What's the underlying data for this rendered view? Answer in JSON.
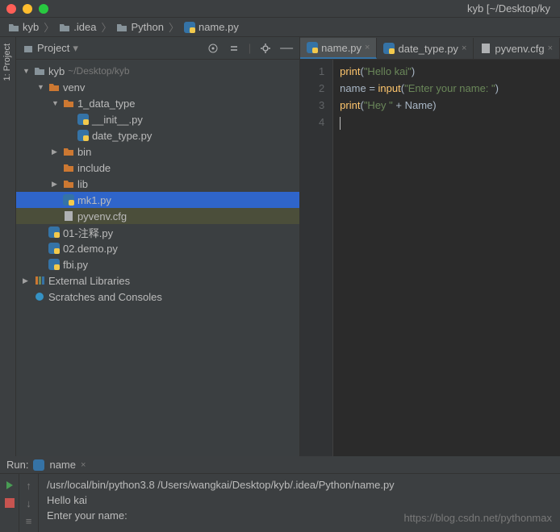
{
  "window": {
    "title": "kyb [~/Desktop/ky"
  },
  "breadcrumb": [
    {
      "icon": "folder",
      "label": "kyb"
    },
    {
      "icon": "folder",
      "label": ".idea"
    },
    {
      "icon": "folder",
      "label": "Python"
    },
    {
      "icon": "python",
      "label": "name.py"
    }
  ],
  "toolstrip": {
    "label": "1: Project"
  },
  "project_panel": {
    "title": "Project",
    "dropdown": "▾",
    "tree": [
      {
        "depth": 0,
        "arrow": "down",
        "icon": "folder-g",
        "label": "kyb",
        "path": "~/Desktop/kyb"
      },
      {
        "depth": 1,
        "arrow": "down",
        "icon": "folder-y",
        "label": "venv"
      },
      {
        "depth": 2,
        "arrow": "down",
        "icon": "folder-y",
        "label": "1_data_type"
      },
      {
        "depth": 3,
        "arrow": "",
        "icon": "python",
        "label": "__init__.py"
      },
      {
        "depth": 3,
        "arrow": "",
        "icon": "python",
        "label": "date_type.py"
      },
      {
        "depth": 2,
        "arrow": "right",
        "icon": "folder-y",
        "label": "bin"
      },
      {
        "depth": 2,
        "arrow": "",
        "icon": "folder-y",
        "label": "include"
      },
      {
        "depth": 2,
        "arrow": "right",
        "icon": "folder-y",
        "label": "lib"
      },
      {
        "depth": 2,
        "arrow": "",
        "icon": "python",
        "label": "mk1.py",
        "selected": true
      },
      {
        "depth": 2,
        "arrow": "",
        "icon": "text",
        "label": "pyvenv.cfg",
        "highlight": true
      },
      {
        "depth": 1,
        "arrow": "",
        "icon": "python",
        "label": "01-注释.py"
      },
      {
        "depth": 1,
        "arrow": "",
        "icon": "python",
        "label": "02.demo.py"
      },
      {
        "depth": 1,
        "arrow": "",
        "icon": "python",
        "label": "fbi.py"
      },
      {
        "depth": 0,
        "arrow": "right",
        "icon": "libs",
        "label": "External Libraries"
      },
      {
        "depth": 0,
        "arrow": "",
        "icon": "scratch",
        "label": "Scratches and Consoles"
      }
    ]
  },
  "editor": {
    "tabs": [
      {
        "icon": "python",
        "label": "name.py",
        "active": true
      },
      {
        "icon": "python",
        "label": "date_type.py",
        "active": false
      },
      {
        "icon": "text",
        "label": "pyvenv.cfg",
        "active": false
      }
    ],
    "lines": [
      "1",
      "2",
      "3",
      "4"
    ],
    "code": {
      "l1": {
        "fn": "print",
        "str": "\"Hello kai\""
      },
      "l2": {
        "var": "name",
        "op": " = ",
        "fn": "input",
        "str": "\"Enter your name: \""
      },
      "l3": {
        "fn": "print",
        "str": "\"Hey \"",
        "op": " + ",
        "var": "Name"
      }
    }
  },
  "run": {
    "title": "Run:",
    "tab": "name",
    "console": [
      "/usr/local/bin/python3.8 /Users/wangkai/Desktop/kyb/.idea/Python/name.py",
      "Hello kai",
      "Enter your name:"
    ],
    "watermark": "https://blog.csdn.net/pythonmax"
  }
}
